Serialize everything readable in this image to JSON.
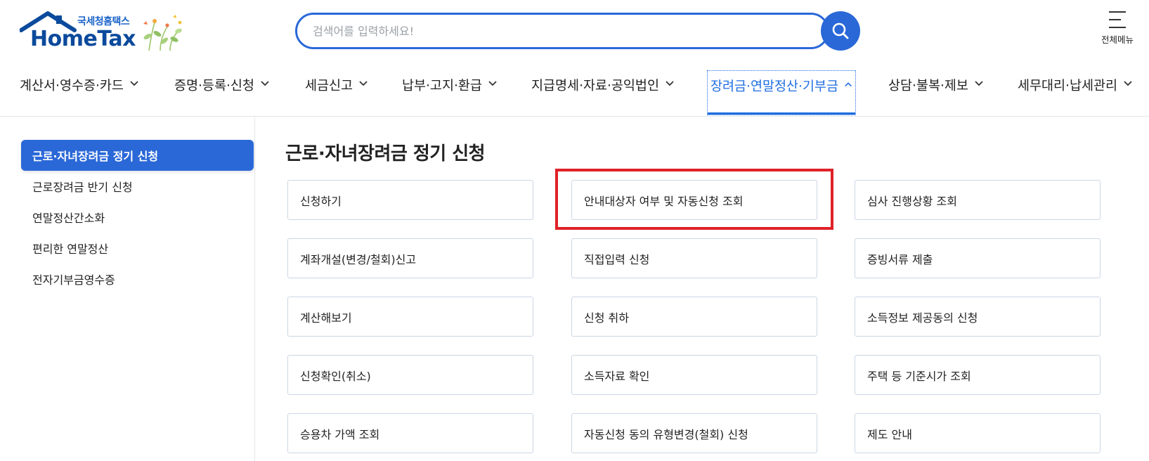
{
  "header": {
    "logo_sub": "국세청홈택스",
    "logo_main": "HomeTax",
    "search_placeholder": "검색어를 입력하세요!",
    "all_menu_label": "전체메뉴"
  },
  "gnb": [
    {
      "label": "계산서·영수증·카드",
      "active": false
    },
    {
      "label": "증명·등록·신청",
      "active": false
    },
    {
      "label": "세금신고",
      "active": false
    },
    {
      "label": "납부·고지·환급",
      "active": false
    },
    {
      "label": "지급명세·자료·공익법인",
      "active": false
    },
    {
      "label": "장려금·연말정산·기부금",
      "active": true
    },
    {
      "label": "상담·불복·제보",
      "active": false
    },
    {
      "label": "세무대리·납세관리",
      "active": false
    }
  ],
  "sidebar": {
    "items": [
      {
        "label": "근로·자녀장려금 정기 신청",
        "active": true
      },
      {
        "label": "근로장려금 반기 신청",
        "active": false
      },
      {
        "label": "연말정산간소화",
        "active": false
      },
      {
        "label": "편리한 연말정산",
        "active": false
      },
      {
        "label": "전자기부금영수증",
        "active": false
      }
    ]
  },
  "main": {
    "title": "근로·자녀장려금 정기 신청",
    "cards": [
      "신청하기",
      "안내대상자 여부 및 자동신청 조회",
      "심사 진행상황 조회",
      "계좌개설(변경/철회)신고",
      "직접입력 신청",
      "증빙서류 제출",
      "계산해보기",
      "신청 취하",
      "소득정보 제공동의 신청",
      "신청확인(취소)",
      "소득자료 확인",
      "주택 등 기준시가 조회",
      "승용차 가액 조회",
      "자동신청 동의 유형변경(철회) 신청",
      "제도 안내"
    ]
  },
  "colors": {
    "primary": "#2a68d8",
    "active_nav": "#1f6de0",
    "logo_blue": "#0b4a9c",
    "highlight": "#e02127",
    "card_border": "#cbd6e6"
  }
}
